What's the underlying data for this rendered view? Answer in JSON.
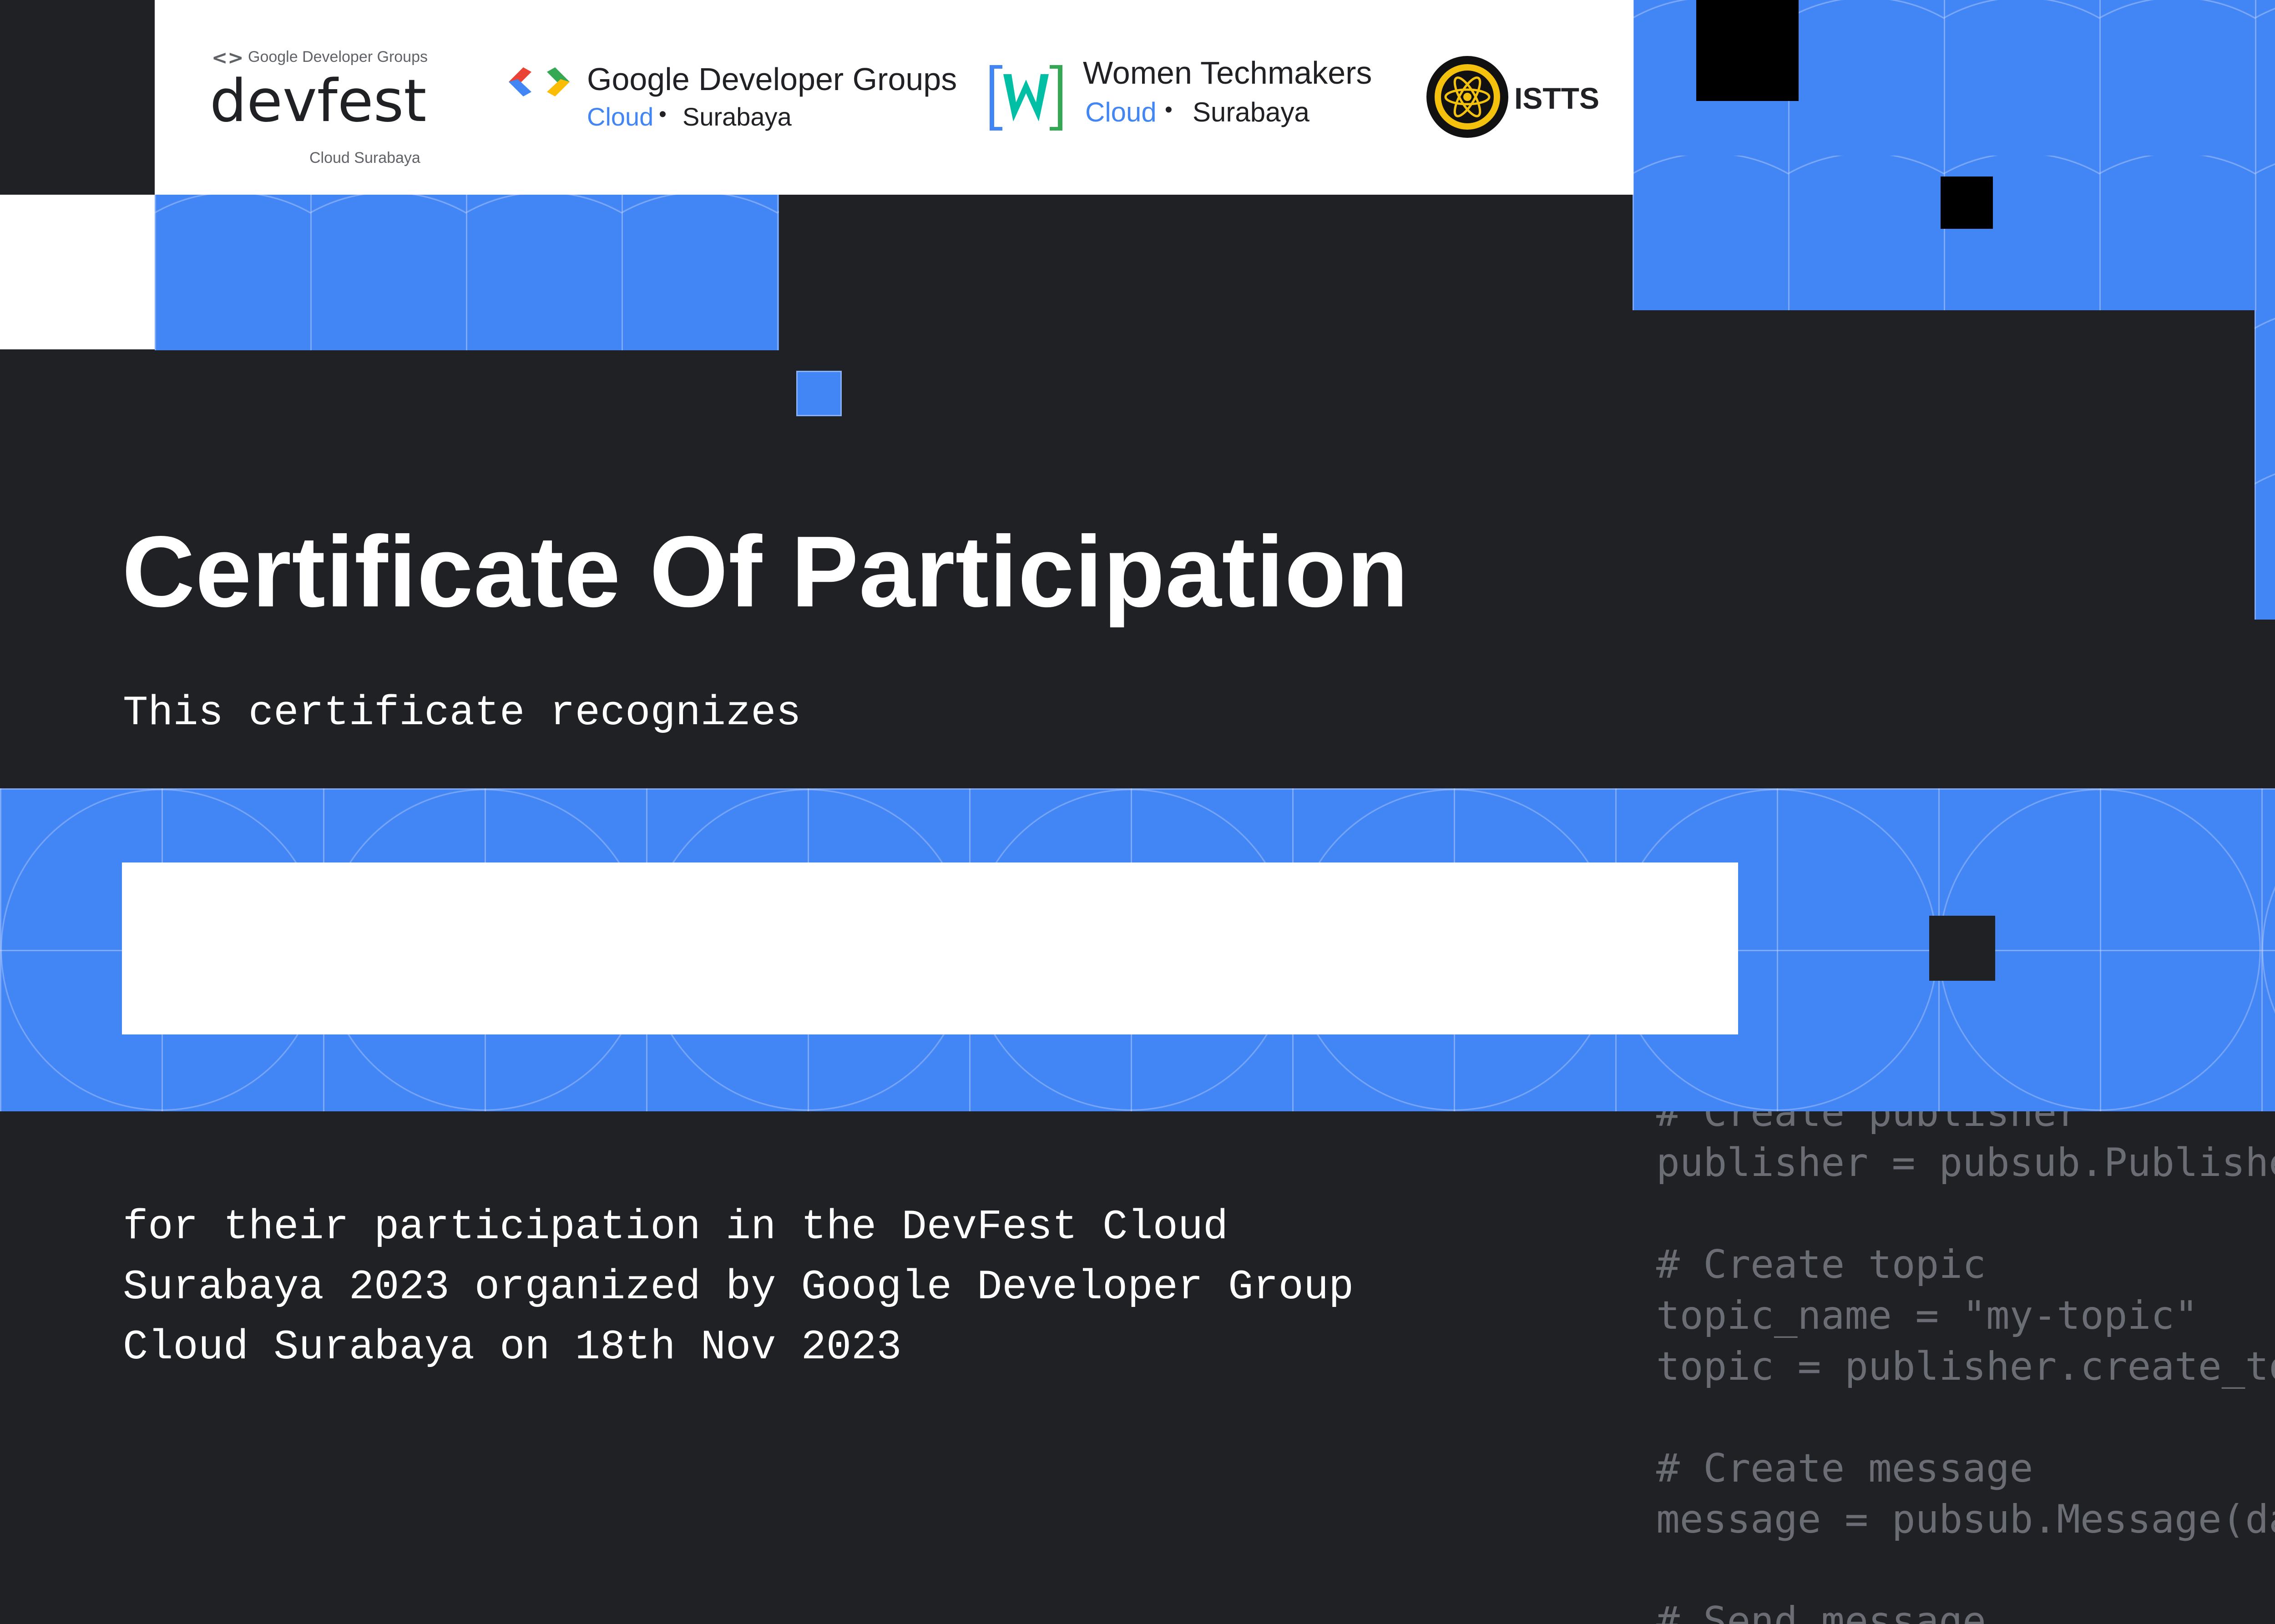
{
  "logos": {
    "devfest": {
      "org": "Google Developer Groups",
      "name": "devfest",
      "sub": "Cloud Surabaya"
    },
    "gdg": {
      "name": "Google Developer Groups",
      "cloud": "Cloud",
      "sep": "•",
      "city": "Surabaya"
    },
    "wtm": {
      "name": "Women Techmakers",
      "cloud": "Cloud",
      "sep": "•",
      "city": "Surabaya"
    },
    "istts": {
      "name": "ISTTS"
    }
  },
  "certificate": {
    "title": "Certificate Of Participation",
    "recognizes": "This certificate recognizes",
    "recipient_name": "",
    "body_lines": [
      "for their participation in the DevFest Cloud",
      "Surabaya 2023 organized by Google Developer Group",
      "Cloud Surabaya on 18th Nov 2023"
    ]
  },
  "code_snippet": [
    "# Create publisher",
    "publisher = pubsub.Publishe",
    "",
    "# Create topic",
    "topic_name = \"my-topic\"",
    "topic = publisher.create_to",
    "",
    "# Create message",
    "message = pubsub.Message(da",
    "",
    "# Send message"
  ],
  "colors": {
    "background": "#202124",
    "accent_blue": "#4285f4",
    "white": "#ffffff",
    "code_gray": "#6a6d73"
  },
  "icons": [
    "gdg-brackets-icon",
    "wtm-w-icon",
    "istts-seal-icon"
  ]
}
